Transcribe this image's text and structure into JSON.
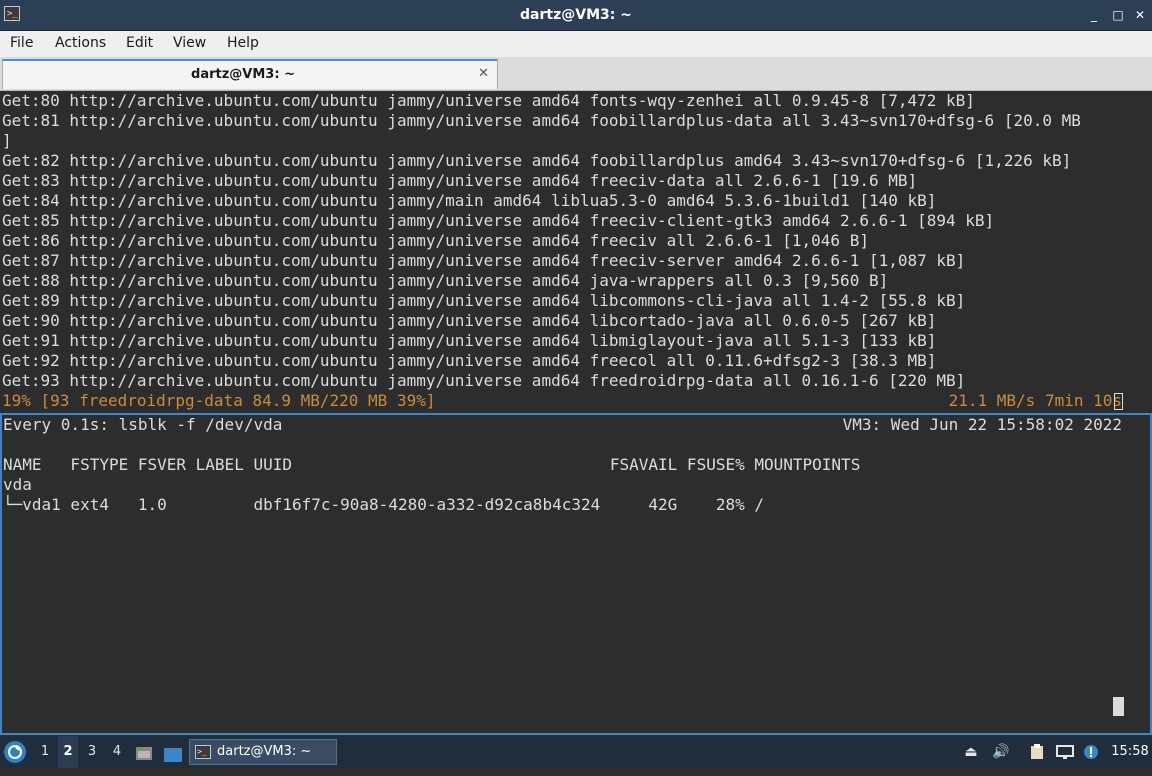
{
  "window": {
    "title": "dartz@VM3: ~",
    "app_icon": "terminal-icon",
    "controls": {
      "minimize": "_",
      "maximize": "□",
      "close": "✕"
    }
  },
  "menu": [
    "File",
    "Actions",
    "Edit",
    "View",
    "Help"
  ],
  "tab": {
    "label": "dartz@VM3: ~",
    "close": "✕"
  },
  "terminal_top": {
    "lines": [
      "Get:80 http://archive.ubuntu.com/ubuntu jammy/universe amd64 fonts-wqy-zenhei all 0.9.45-8 [7,472 kB]",
      "Get:81 http://archive.ubuntu.com/ubuntu jammy/universe amd64 foobillardplus-data all 3.43~svn170+dfsg-6 [20.0 MB",
      "]",
      "Get:82 http://archive.ubuntu.com/ubuntu jammy/universe amd64 foobillardplus amd64 3.43~svn170+dfsg-6 [1,226 kB]",
      "Get:83 http://archive.ubuntu.com/ubuntu jammy/universe amd64 freeciv-data all 2.6.6-1 [19.6 MB]",
      "Get:84 http://archive.ubuntu.com/ubuntu jammy/main amd64 liblua5.3-0 amd64 5.3.6-1build1 [140 kB]",
      "Get:85 http://archive.ubuntu.com/ubuntu jammy/universe amd64 freeciv-client-gtk3 amd64 2.6.6-1 [894 kB]",
      "Get:86 http://archive.ubuntu.com/ubuntu jammy/universe amd64 freeciv all 2.6.6-1 [1,046 B]",
      "Get:87 http://archive.ubuntu.com/ubuntu jammy/universe amd64 freeciv-server amd64 2.6.6-1 [1,087 kB]",
      "Get:88 http://archive.ubuntu.com/ubuntu jammy/universe amd64 java-wrappers all 0.3 [9,560 B]",
      "Get:89 http://archive.ubuntu.com/ubuntu jammy/universe amd64 libcommons-cli-java all 1.4-2 [55.8 kB]",
      "Get:90 http://archive.ubuntu.com/ubuntu jammy/universe amd64 libcortado-java all 0.6.0-5 [267 kB]",
      "Get:91 http://archive.ubuntu.com/ubuntu jammy/universe amd64 libmiglayout-java all 5.1-3 [133 kB]",
      "Get:92 http://archive.ubuntu.com/ubuntu jammy/universe amd64 freecol all 0.11.6+dfsg2-3 [38.3 MB]",
      "Get:93 http://archive.ubuntu.com/ubuntu jammy/universe amd64 freedroidrpg-data all 0.16.1-6 [220 MB]"
    ],
    "progress_left": "19% [93 freedroidrpg-data 84.9 MB/220 MB 39%]",
    "progress_right": "21.1 MB/s 7min 10s"
  },
  "terminal_bottom": {
    "watch_command": "Every 0.1s: lsblk -f /dev/vda",
    "watch_status": "VM3: Wed Jun 22 15:58:02 2022",
    "header": "NAME   FSTYPE FSVER LABEL UUID                                 FSAVAIL FSUSE% MOUNTPOINTS",
    "rows": [
      "vda",
      "└─vda1 ext4   1.0         dbf16f7c-90a8-4280-a332-d92ca8b4c324     42G    28% /"
    ]
  },
  "taskbar": {
    "start_icon": "start-menu-icon",
    "workspaces": [
      "1",
      "2",
      "3",
      "4"
    ],
    "active_workspace": "2",
    "launchers": [
      "file-manager-icon",
      "show-desktop-icon"
    ],
    "window_button": "dartz@VM3: ~",
    "tray_icons": [
      "eject-icon",
      "volume-icon",
      "clipboard-icon",
      "network-icon",
      "notification-icon"
    ],
    "clock": "15:58"
  }
}
